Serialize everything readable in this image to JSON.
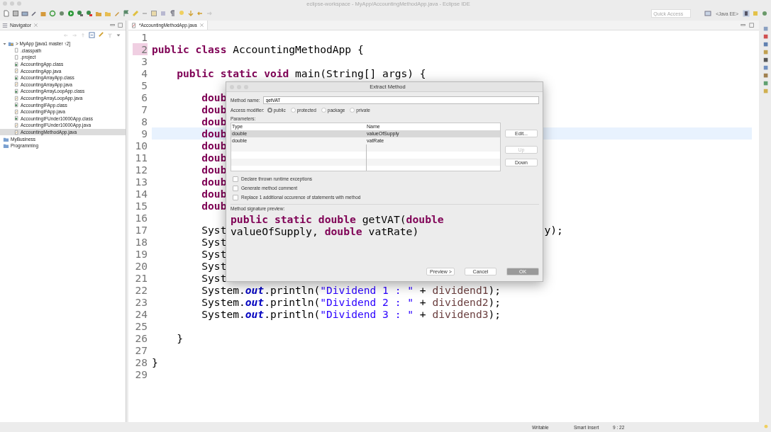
{
  "window": {
    "title": "eclipse-workspace - MyApp/AccountingMethodApp.java - Eclipse IDE"
  },
  "toolbar": {
    "quick_access": {
      "placeholder": "Quick Access"
    },
    "perspective": "<Java EE>"
  },
  "navigator": {
    "title": "Navigator",
    "tree": [
      {
        "label": "> MyApp [java1 master ↑2]",
        "kind": "project",
        "expanded": true,
        "selected": false,
        "children": [
          {
            "label": ".classpath",
            "kind": "file",
            "selected": false
          },
          {
            "label": ".project",
            "kind": "file",
            "selected": false
          },
          {
            "label": "AccountingApp.class",
            "kind": "class",
            "selected": false
          },
          {
            "label": "AccountingApp.java",
            "kind": "java",
            "selected": false
          },
          {
            "label": "AccountingArrayApp.class",
            "kind": "class",
            "selected": false
          },
          {
            "label": "AccountingArrayApp.java",
            "kind": "java",
            "selected": false
          },
          {
            "label": "AccountingArrayLoopApp.class",
            "kind": "class",
            "selected": false
          },
          {
            "label": "AccountingArrayLoopApp.java",
            "kind": "java",
            "selected": false
          },
          {
            "label": "AccountingIFApp.class",
            "kind": "class",
            "selected": false
          },
          {
            "label": "AccountingIFApp.java",
            "kind": "java",
            "selected": false
          },
          {
            "label": "AccountingIFUnder10000App.class",
            "kind": "class",
            "selected": false
          },
          {
            "label": "AccountingIFUnder10000App.java",
            "kind": "java",
            "selected": false
          },
          {
            "label": "AccountingMethodApp.java",
            "kind": "java",
            "selected": true
          }
        ]
      },
      {
        "label": "MyBusiness",
        "kind": "folder",
        "selected": false
      },
      {
        "label": "Programming",
        "kind": "folder",
        "selected": false
      }
    ]
  },
  "editor": {
    "tab": {
      "label": "*AccountingMethodApp.java",
      "selected": true
    },
    "lines": [
      {
        "n": "1",
        "current": false,
        "marked": false
      },
      {
        "n": "2",
        "current": false,
        "marked": true,
        "tokens": [
          {
            "kind": "keyword",
            "text": "public class"
          },
          {
            "kind": "plain",
            "text": " AccountingMethodApp {"
          }
        ]
      },
      {
        "n": "3",
        "current": false,
        "marked": false
      },
      {
        "n": "4",
        "current": false,
        "marked": false,
        "tokens": [
          {
            "kind": "keyword",
            "text": "    public static void"
          },
          {
            "kind": "plain",
            "text": " main(String[] args) {"
          }
        ]
      },
      {
        "n": "5",
        "current": false,
        "marked": false
      },
      {
        "n": "6",
        "current": false,
        "marked": false,
        "tokens": [
          {
            "kind": "keyword",
            "text": "        doub"
          }
        ]
      },
      {
        "n": "7",
        "current": false,
        "marked": false,
        "tokens": [
          {
            "kind": "keyword",
            "text": "        doub"
          }
        ]
      },
      {
        "n": "8",
        "current": false,
        "marked": false,
        "tokens": [
          {
            "kind": "keyword",
            "text": "        doub"
          }
        ]
      },
      {
        "n": "9",
        "current": true,
        "marked": false,
        "tokens": [
          {
            "kind": "keyword",
            "text": "        doub"
          }
        ]
      },
      {
        "n": "10",
        "current": false,
        "marked": false,
        "tokens": [
          {
            "kind": "keyword",
            "text": "        doub"
          }
        ]
      },
      {
        "n": "11",
        "current": false,
        "marked": false,
        "tokens": [
          {
            "kind": "keyword",
            "text": "        doub"
          }
        ]
      },
      {
        "n": "12",
        "current": false,
        "marked": false,
        "tokens": [
          {
            "kind": "keyword",
            "text": "        doub"
          }
        ]
      },
      {
        "n": "13",
        "current": false,
        "marked": false,
        "tokens": [
          {
            "kind": "keyword",
            "text": "        doub"
          }
        ]
      },
      {
        "n": "14",
        "current": false,
        "marked": false,
        "tokens": [
          {
            "kind": "keyword",
            "text": "        doub"
          }
        ]
      },
      {
        "n": "15",
        "current": false,
        "marked": false,
        "tokens": [
          {
            "kind": "keyword",
            "text": "        doub"
          }
        ]
      },
      {
        "n": "16",
        "current": false,
        "marked": false
      },
      {
        "n": "17",
        "current": false,
        "marked": false,
        "tokens": [
          {
            "kind": "plain",
            "text": "        Syst"
          },
          {
            "kind": "tail",
            "text": "y);"
          }
        ]
      },
      {
        "n": "18",
        "current": false,
        "marked": false,
        "tokens": [
          {
            "kind": "plain",
            "text": "        Syst"
          }
        ]
      },
      {
        "n": "19",
        "current": false,
        "marked": false,
        "tokens": [
          {
            "kind": "plain",
            "text": "        Syst"
          }
        ]
      },
      {
        "n": "20",
        "current": false,
        "marked": false,
        "tokens": [
          {
            "kind": "plain",
            "text": "        Syst"
          }
        ]
      },
      {
        "n": "21",
        "current": false,
        "marked": false,
        "tokens": [
          {
            "kind": "plain",
            "text": "        Syst"
          }
        ]
      },
      {
        "n": "22",
        "current": false,
        "marked": false,
        "tokens": [
          {
            "kind": "plain",
            "text": "        System."
          },
          {
            "kind": "field",
            "text": "out"
          },
          {
            "kind": "plain",
            "text": ".println("
          },
          {
            "kind": "string",
            "text": "\"Dividend 1 : \""
          },
          {
            "kind": "plain",
            "text": " + "
          },
          {
            "kind": "var",
            "text": "dividend1"
          },
          {
            "kind": "plain",
            "text": ");"
          }
        ]
      },
      {
        "n": "23",
        "current": false,
        "marked": false,
        "tokens": [
          {
            "kind": "plain",
            "text": "        System."
          },
          {
            "kind": "field",
            "text": "out"
          },
          {
            "kind": "plain",
            "text": ".println("
          },
          {
            "kind": "string",
            "text": "\"Dividend 2 : \""
          },
          {
            "kind": "plain",
            "text": " + "
          },
          {
            "kind": "var",
            "text": "dividend2"
          },
          {
            "kind": "plain",
            "text": ");"
          }
        ]
      },
      {
        "n": "24",
        "current": false,
        "marked": false,
        "tokens": [
          {
            "kind": "plain",
            "text": "        System."
          },
          {
            "kind": "field",
            "text": "out"
          },
          {
            "kind": "plain",
            "text": ".println("
          },
          {
            "kind": "string",
            "text": "\"Dividend 3 : \""
          },
          {
            "kind": "plain",
            "text": " + "
          },
          {
            "kind": "var",
            "text": "dividend3"
          },
          {
            "kind": "plain",
            "text": ");"
          }
        ]
      },
      {
        "n": "25",
        "current": false,
        "marked": false
      },
      {
        "n": "26",
        "current": false,
        "marked": false,
        "tokens": [
          {
            "kind": "plain",
            "text": "    }"
          }
        ]
      },
      {
        "n": "27",
        "current": false,
        "marked": false
      },
      {
        "n": "28",
        "current": false,
        "marked": false,
        "tokens": [
          {
            "kind": "plain",
            "text": "}"
          }
        ]
      },
      {
        "n": "29",
        "current": false,
        "marked": false
      }
    ]
  },
  "dialog": {
    "title": "Extract Method",
    "method_name": {
      "label": "Method name:",
      "value": "getVAT"
    },
    "access_modifier": {
      "label": "Access modifier:",
      "options": [
        {
          "label": "public",
          "selected": true
        },
        {
          "label": "protected",
          "selected": false
        },
        {
          "label": "package",
          "selected": false
        },
        {
          "label": "private",
          "selected": false
        }
      ]
    },
    "parameters": {
      "label": "Parameters:",
      "columns": [
        "Type",
        "Name"
      ],
      "rows": [
        {
          "type": "double",
          "name": "valueOfSupply",
          "selected": true
        },
        {
          "type": "double",
          "name": "vatRate",
          "selected": false
        }
      ],
      "buttons": [
        {
          "label": "Edit...",
          "disabled": false
        },
        {
          "label": "Up",
          "disabled": true
        },
        {
          "label": "Down",
          "disabled": false
        }
      ]
    },
    "options": [
      {
        "label": "Declare thrown runtime exceptions",
        "checked": false
      },
      {
        "label": "Generate method comment",
        "checked": false
      },
      {
        "label": "Replace 1 additional occurence of statements with method",
        "checked": false
      }
    ],
    "preview": {
      "label": "Method signature preview:",
      "lines": [
        [
          {
            "kind": "keyword",
            "text": "public static double"
          },
          {
            "kind": "plain",
            "text": " getVAT("
          },
          {
            "kind": "keyword",
            "text": "double"
          }
        ],
        [
          {
            "kind": "plain",
            "text": "valueOfSupply, "
          },
          {
            "kind": "keyword",
            "text": "double"
          },
          {
            "kind": "plain",
            "text": " vatRate)"
          }
        ]
      ]
    },
    "buttons": [
      {
        "label": "Preview >",
        "default": false
      },
      {
        "label": "Cancel",
        "default": false
      },
      {
        "label": "OK",
        "default": true
      }
    ]
  },
  "status_bar": {
    "items": [
      "Writable",
      "Smart Insert",
      "9 : 22"
    ]
  }
}
